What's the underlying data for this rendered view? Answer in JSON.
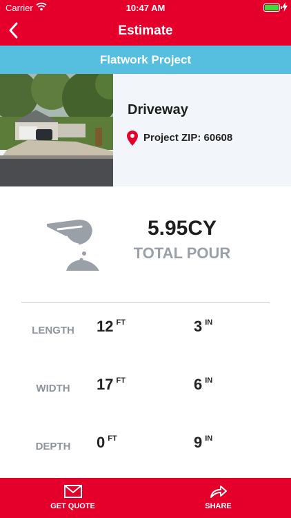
{
  "status": {
    "carrier": "Carrier",
    "time": "10:47 AM",
    "icons": [
      "wifi-icon",
      "battery-icon",
      "charging-icon"
    ]
  },
  "nav": {
    "title": "Estimate",
    "back_icon": "chevron-left-icon"
  },
  "project": {
    "type": "Flatwork Project",
    "name": "Driveway",
    "zip": "Project ZIP: 60608"
  },
  "total": {
    "value": "5.95CY",
    "label": "TOTAL POUR",
    "icon": "concrete-pour-icon"
  },
  "dimensions": [
    {
      "label": "LENGTH",
      "feet": "12",
      "feet_unit": "FT",
      "inches": "3",
      "inches_unit": "IN"
    },
    {
      "label": "WIDTH",
      "feet": "17",
      "feet_unit": "FT",
      "inches": "6",
      "inches_unit": "IN"
    },
    {
      "label": "DEPTH",
      "feet": "0",
      "feet_unit": "FT",
      "inches": "9",
      "inches_unit": "IN"
    }
  ],
  "tabs": [
    {
      "label": "GET QUOTE",
      "icon": "envelope-icon"
    },
    {
      "label": "SHARE",
      "icon": "share-arrow-icon"
    }
  ],
  "colors": {
    "primary": "#e4002b",
    "accent": "#56bedf",
    "info_bg": "#f2f5f9",
    "muted": "#9aa0a8"
  }
}
